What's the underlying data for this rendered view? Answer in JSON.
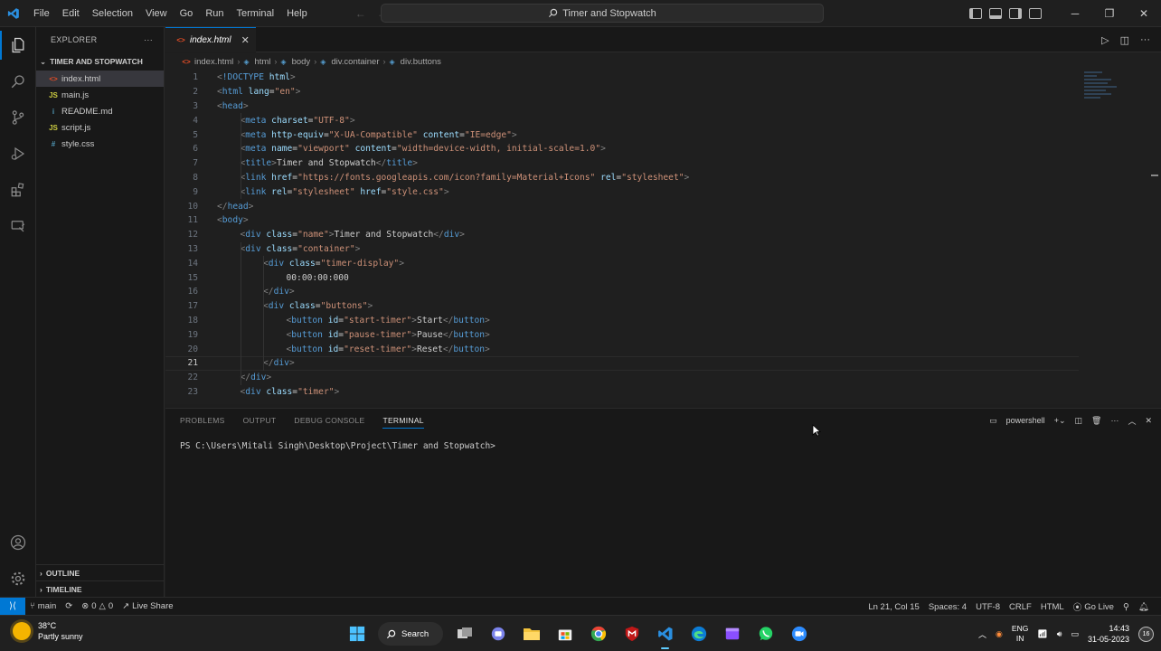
{
  "titlebar": {
    "menus": [
      "File",
      "Edit",
      "Selection",
      "View",
      "Go",
      "Run",
      "Terminal",
      "Help"
    ],
    "command_center": "Timer and Stopwatch"
  },
  "sidebar": {
    "title": "EXPLORER",
    "folder": "TIMER AND STOPWATCH",
    "files": [
      {
        "icon": "<>",
        "name": "index.html",
        "type": "html"
      },
      {
        "icon": "JS",
        "name": "main.js",
        "type": "js"
      },
      {
        "icon": "i",
        "name": "README.md",
        "type": "md"
      },
      {
        "icon": "JS",
        "name": "script.js",
        "type": "js"
      },
      {
        "icon": "#",
        "name": "style.css",
        "type": "css"
      }
    ],
    "outline": "OUTLINE",
    "timeline": "TIMELINE"
  },
  "tab": {
    "name": "index.html"
  },
  "breadcrumb": [
    "index.html",
    "html",
    "body",
    "div.container",
    "div.buttons"
  ],
  "editor": {
    "current_line": 21,
    "lines": [
      {
        "n": "1",
        "indent": 0,
        "text": "<!DOCTYPE html>"
      },
      {
        "n": "2",
        "indent": 0,
        "text": "<html lang=\"en\">"
      },
      {
        "n": "3",
        "indent": 0,
        "text": "<head>"
      },
      {
        "n": "4",
        "indent": 1,
        "text": "<meta charset=\"UTF-8\">"
      },
      {
        "n": "5",
        "indent": 1,
        "text": "<meta http-equiv=\"X-UA-Compatible\" content=\"IE=edge\">"
      },
      {
        "n": "6",
        "indent": 1,
        "text": "<meta name=\"viewport\" content=\"width=device-width, initial-scale=1.0\">"
      },
      {
        "n": "7",
        "indent": 1,
        "text": "<title>Timer and Stopwatch</title>"
      },
      {
        "n": "8",
        "indent": 1,
        "text": "<link href=\"https://fonts.googleapis.com/icon?family=Material+Icons\" rel=\"stylesheet\">"
      },
      {
        "n": "9",
        "indent": 1,
        "text": "<link rel=\"stylesheet\" href=\"style.css\">"
      },
      {
        "n": "10",
        "indent": 0,
        "text": "</head>"
      },
      {
        "n": "11",
        "indent": 0,
        "text": "<body>"
      },
      {
        "n": "12",
        "indent": 1,
        "text": "<div class=\"name\">Timer and Stopwatch</div>"
      },
      {
        "n": "13",
        "indent": 1,
        "text": "<div class=\"container\">"
      },
      {
        "n": "14",
        "indent": 2,
        "text": "<div class=\"timer-display\">"
      },
      {
        "n": "15",
        "indent": 3,
        "text": "00:00:00:000"
      },
      {
        "n": "16",
        "indent": 2,
        "text": "</div>"
      },
      {
        "n": "17",
        "indent": 2,
        "text": "<div class=\"buttons\">"
      },
      {
        "n": "18",
        "indent": 3,
        "text": "<button id=\"start-timer\">Start</button>"
      },
      {
        "n": "19",
        "indent": 3,
        "text": "<button id=\"pause-timer\">Pause</button>"
      },
      {
        "n": "20",
        "indent": 3,
        "text": "<button id=\"reset-timer\">Reset</button>"
      },
      {
        "n": "21",
        "indent": 2,
        "text": "</div>"
      },
      {
        "n": "22",
        "indent": 1,
        "text": "</div>"
      },
      {
        "n": "23",
        "indent": 1,
        "text": "<div class=\"timer\">"
      }
    ]
  },
  "panel": {
    "tabs": [
      "PROBLEMS",
      "OUTPUT",
      "DEBUG CONSOLE",
      "TERMINAL"
    ],
    "active_tab": "TERMINAL",
    "shell": "powershell",
    "prompt": "PS C:\\Users\\Mitali Singh\\Desktop\\Project\\Timer and Stopwatch>"
  },
  "statusbar": {
    "branch": "main",
    "errors": "0",
    "warnings": "0",
    "live_share": "Live Share",
    "position": "Ln 21, Col 15",
    "spaces": "Spaces: 4",
    "encoding": "UTF-8",
    "eol": "CRLF",
    "language": "HTML",
    "go_live": "Go Live"
  },
  "taskbar": {
    "temperature": "38°C",
    "weather": "Partly sunny",
    "search": "Search",
    "lang_top": "ENG",
    "lang_bottom": "IN",
    "time": "14:43",
    "date": "31-05-2023",
    "notifications": "16"
  },
  "colors": {
    "tag": "#569cd6",
    "attr": "#9cdcfe",
    "string": "#ce9178",
    "bracket": "#808080",
    "accent": "#0078d4"
  }
}
